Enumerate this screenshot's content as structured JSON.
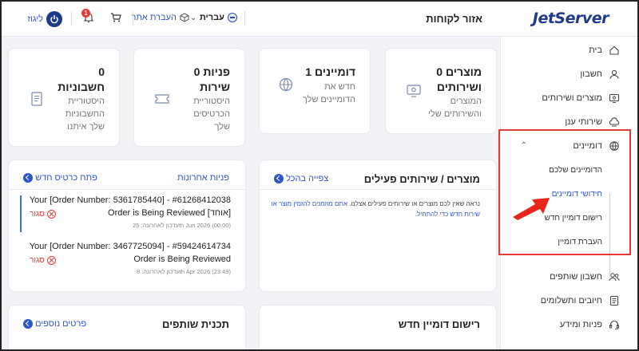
{
  "header": {
    "logo": "JetServer",
    "page_title": "אזור לקוחות",
    "language": "עברית",
    "transfer": "העברת אתר",
    "notifications_count": "1",
    "logout": "ליגוז"
  },
  "sidebar": {
    "items": [
      {
        "label": "בית",
        "icon": "home-icon"
      },
      {
        "label": "חשבון",
        "icon": "user-icon"
      },
      {
        "label": "מוצרים ושירותים",
        "icon": "server-icon"
      },
      {
        "label": "שירותי ענן",
        "icon": "cloud-icon"
      },
      {
        "label": "דומיינים",
        "icon": "globe-icon"
      },
      {
        "label": "חשבון שותפים",
        "icon": "users-icon"
      },
      {
        "label": "חיובים ותשלומים",
        "icon": "invoice-icon"
      },
      {
        "label": "פניות ומידע",
        "icon": "headset-icon"
      }
    ],
    "domain_sub": [
      {
        "label": "הדומיינים שלכם"
      },
      {
        "label": "חידושי דומיינים"
      },
      {
        "label": "רישום דומיין חדש"
      },
      {
        "label": "העברת דומיין"
      }
    ]
  },
  "stats": [
    {
      "title": "0 מוצרים ושירותים",
      "title1": "0 מוצרים",
      "title2": "ושירותים",
      "sub1": "המוצרים",
      "sub2": "והשירותים שלי"
    },
    {
      "title1": "1 דומיינים",
      "sub1": "חדש את",
      "sub2": "הדומיינים שלך"
    },
    {
      "title1": "0 פניות",
      "title2": "שירות",
      "sub1": "היסטוריית",
      "sub2": "הכרטיסים",
      "sub3": "שלך"
    },
    {
      "title1": "0",
      "title2": "חשבוניות",
      "sub1": "היסטוריית",
      "sub2": "החשבוניות",
      "sub3": "שלך איתנו"
    }
  ],
  "products_panel": {
    "title": "מוצרים / שירותים פעילים",
    "view_all": "צפייה בהכל",
    "text_line1": "נראה שאין לכם מוצרים או שירותים פעילים אצלנו.",
    "text_link1": "אתם מוזמנים להזמין מוצר",
    "text_link2": "או שירות חדש כדי להתחיל."
  },
  "tickets_panel": {
    "title": "פניות אחרונות",
    "open_new": "פתח כרטיס חדש",
    "tickets": [
      {
        "line1": "Your [Order Number: 5361785440] - #61268412038",
        "line2": "Order is Being Reviewed [אוחד]",
        "meta": "עדכון לאחרונה: 25th Jun 2026 (00:00)",
        "status": "סגור"
      },
      {
        "line1": "Your [Order Number: 3467725094] - #59424614734",
        "line2": "Order is Being Reviewed",
        "meta": "עדכון לאחרונה: 8th Apr 2026 (23:49)",
        "status": "סגור"
      }
    ]
  },
  "domain_register_panel": {
    "title": "רישום דומיין חדש"
  },
  "affiliate_panel": {
    "title": "תכנית שותפים",
    "more": "פרטים נוספים"
  }
}
